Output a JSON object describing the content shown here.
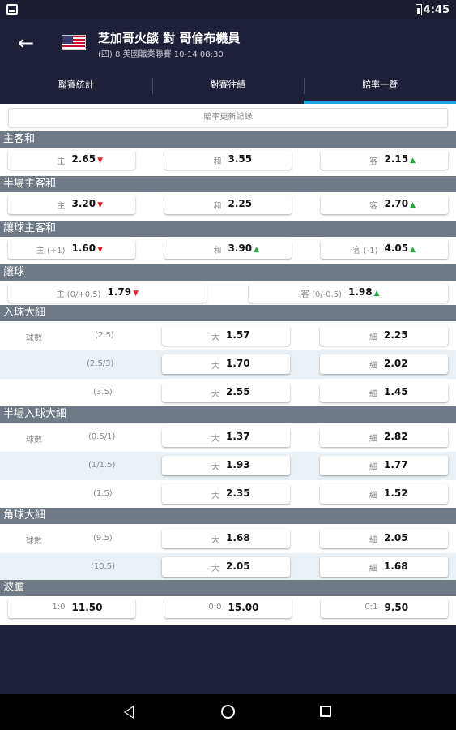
{
  "status": {
    "time": "4:45"
  },
  "header": {
    "title": "芝加哥火燄 對 哥倫布機員",
    "subtitle": "(四) 8  美國職業聯賽  10-14 08:30"
  },
  "tabs": [
    "聯賽統計",
    "對賽往績",
    "賠率一覽"
  ],
  "update_link": "賠率更新記錄",
  "sections": {
    "s1": "主客和",
    "s2": "半場主客和",
    "s3": "讓球主客和",
    "s4": "讓球",
    "s5": "入球大細",
    "s6": "半場入球大細",
    "s7": "角球大細",
    "s8": "波膽"
  },
  "zkh": {
    "home": {
      "label": "主",
      "value": "2.65",
      "trend": "down"
    },
    "draw": {
      "label": "和",
      "value": "3.55",
      "trend": ""
    },
    "away": {
      "label": "客",
      "value": "2.15",
      "trend": "up"
    }
  },
  "bczkh": {
    "home": {
      "label": "主",
      "value": "3.20",
      "trend": "down"
    },
    "draw": {
      "label": "和",
      "value": "2.25",
      "trend": ""
    },
    "away": {
      "label": "客",
      "value": "2.70",
      "trend": "up"
    }
  },
  "rqzkh": {
    "home": {
      "label": "主 (+1)",
      "value": "1.60",
      "trend": "down"
    },
    "draw": {
      "label": "和",
      "value": "3.90",
      "trend": "up"
    },
    "away": {
      "label": "客 (-1)",
      "value": "4.05",
      "trend": "up"
    }
  },
  "rq": {
    "home": {
      "label": "主 (0/+0.5)",
      "value": "1.79",
      "trend": "down"
    },
    "away": {
      "label": "客 (0/-0.5)",
      "value": "1.98",
      "trend": "up"
    }
  },
  "goals_label": "球數",
  "big_label": "大",
  "small_label": "細",
  "ou": [
    {
      "line": "(2.5)",
      "big": "1.57",
      "small": "2.25"
    },
    {
      "line": "(2.5/3)",
      "big": "1.70",
      "small": "2.02"
    },
    {
      "line": "(3.5)",
      "big": "2.55",
      "small": "1.45"
    }
  ],
  "hou": [
    {
      "line": "(0.5/1)",
      "big": "1.37",
      "small": "2.82"
    },
    {
      "line": "(1/1.5)",
      "big": "1.93",
      "small": "1.77"
    },
    {
      "line": "(1.5)",
      "big": "2.35",
      "small": "1.52"
    }
  ],
  "corner": [
    {
      "line": "(9.5)",
      "big": "1.68",
      "small": "2.05"
    },
    {
      "line": "(10.5)",
      "big": "2.05",
      "small": "1.68"
    }
  ],
  "cs": [
    {
      "label": "1:0",
      "value": "11.50"
    },
    {
      "label": "0:0",
      "value": "15.00"
    },
    {
      "label": "0:1",
      "value": "9.50"
    }
  ],
  "colors": {
    "accent": "#1ca8e0",
    "down": "#e0232b",
    "up": "#1fa83c",
    "section": "#707a87",
    "dark": "#1f2039"
  }
}
